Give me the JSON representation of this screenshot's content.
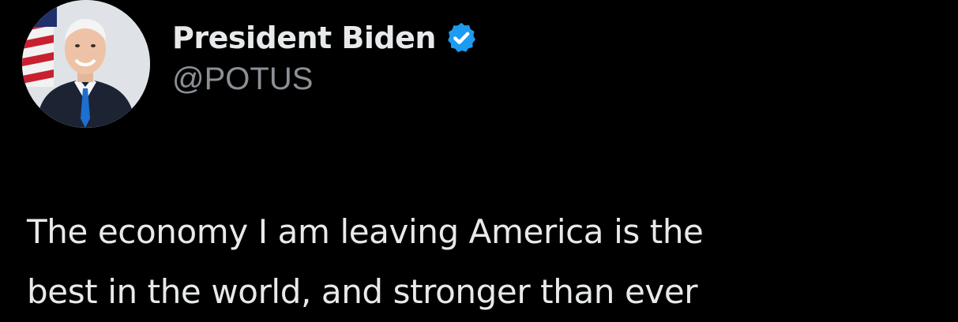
{
  "author": {
    "display_name": "President Biden",
    "handle": "@POTUS",
    "verified": true,
    "verified_badge_color": "#1d9bf0"
  },
  "tweet": {
    "text_lines": [
      "The economy I am leaving America is the",
      "best in the world, and stronger than ever"
    ]
  },
  "colors": {
    "background": "#000000",
    "primary_text": "#e7e9ea",
    "secondary_text": "#8b9096"
  }
}
